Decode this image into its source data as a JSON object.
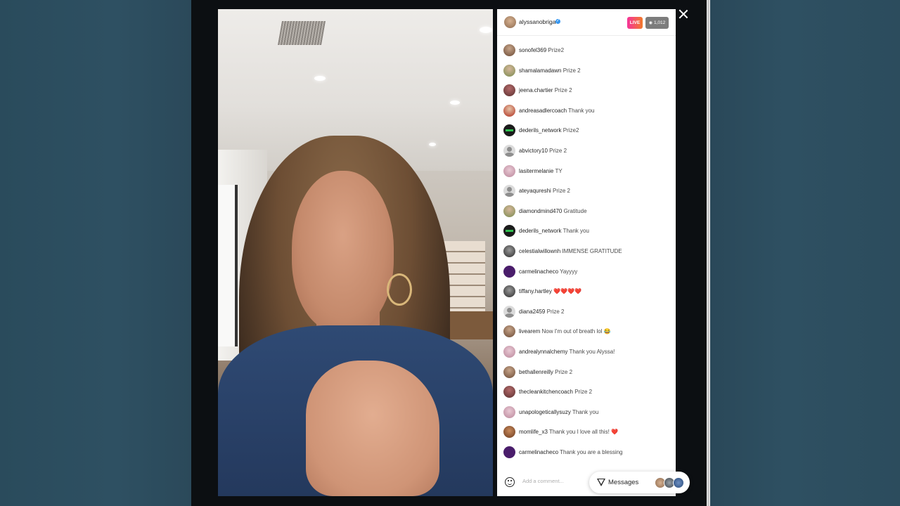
{
  "header": {
    "username": "alyssanobriga",
    "live_label": "LIVE",
    "viewer_count": "1,012"
  },
  "comments": [
    {
      "user": "sonofel369",
      "text": "Prize2",
      "avatar": "photo1"
    },
    {
      "user": "shamalamadawn",
      "text": "Prize 2",
      "avatar": "photo2"
    },
    {
      "user": "jeena.chartier",
      "text": "Prize 2",
      "avatar": "photo3"
    },
    {
      "user": "andreasadlercoach",
      "text": "Thank you",
      "avatar": "photo4"
    },
    {
      "user": "dederils_network",
      "text": "Prize2",
      "avatar": "dark"
    },
    {
      "user": "abvictory10",
      "text": "Prize 2",
      "avatar": "default"
    },
    {
      "user": "lasitermelanie",
      "text": "TY",
      "avatar": "pink"
    },
    {
      "user": "ateyaqureshi",
      "text": "Prize 2",
      "avatar": "default"
    },
    {
      "user": "diamondmind470",
      "text": "Gratitude",
      "avatar": "photo2"
    },
    {
      "user": "dederils_network",
      "text": "Thank you",
      "avatar": "dark"
    },
    {
      "user": "celestialwillownh",
      "text": "IMMENSE GRATITUDE",
      "avatar": "gray"
    },
    {
      "user": "carmelinacheco",
      "text": "Yayyyy",
      "avatar": "purple"
    },
    {
      "user": "tiffany.hartley",
      "text": "❤️❤️❤️❤️",
      "avatar": "gray"
    },
    {
      "user": "diana2459",
      "text": "Prize 2",
      "avatar": "default"
    },
    {
      "user": "livearem",
      "text": "Now I'm out of breath lol 😂",
      "avatar": "photo1"
    },
    {
      "user": "andrealynnalchemy",
      "text": "Thank you Alyssa!",
      "avatar": "pink"
    },
    {
      "user": "bethallenreilly",
      "text": "Prize 2",
      "avatar": "photo1"
    },
    {
      "user": "thecleankitchencoach",
      "text": "Prize 2",
      "avatar": "photo3"
    },
    {
      "user": "unapologeticallysuzy",
      "text": "Thank you",
      "avatar": "pink"
    },
    {
      "user": "momlife_x3",
      "text": "Thank you I love all this! ❤️",
      "avatar": "brown"
    },
    {
      "user": "carmelinacheco",
      "text": "Thank you are a blessing",
      "avatar": "purple"
    }
  ],
  "footer": {
    "comment_placeholder": "Add a comment...",
    "messages_label": "Messages"
  },
  "icons": {
    "close": "close-icon",
    "emoji": "smile-icon",
    "messages": "send-icon"
  },
  "colors": {
    "live_gradient_start": "#f5339a",
    "live_gradient_end": "#f27a2a",
    "verified": "#3797f0"
  }
}
